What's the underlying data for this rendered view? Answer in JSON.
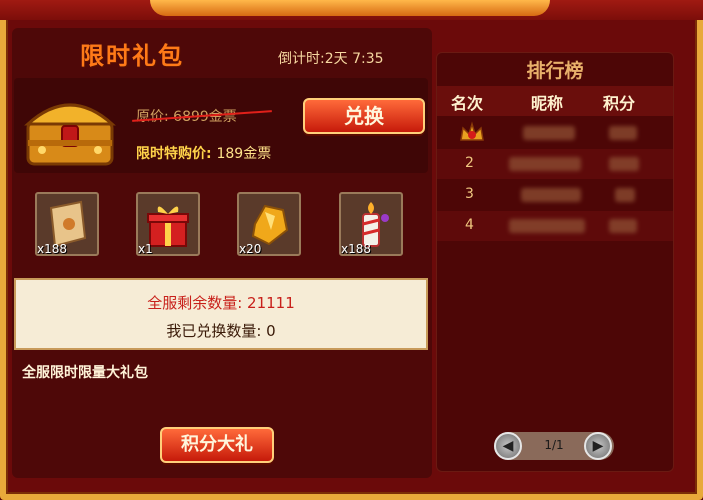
{
  "header": {
    "title": "限时礼包",
    "countdown": "倒计时:2天 7:35"
  },
  "offer": {
    "original_price": "原价: 6899金票",
    "sale_label": "限时特购价:",
    "sale_price": "189金票",
    "exchange_label": "兑换"
  },
  "items": [
    {
      "icon": "scroll-icon",
      "count": "x188"
    },
    {
      "icon": "gift-box-icon",
      "count": "x1"
    },
    {
      "icon": "gold-ore-icon",
      "count": "x20"
    },
    {
      "icon": "candle-icon",
      "count": "x188"
    }
  ],
  "stats": {
    "server_remaining": "全服剩余数量: 21111",
    "my_exchanged": "我已兑换数量: 0"
  },
  "description": "全服限时限量大礼包",
  "points_button": "积分大礼",
  "leaderboard": {
    "title": "排行榜",
    "columns": [
      "名次",
      "昵称",
      "积分"
    ],
    "rows": [
      {
        "rank": ""
      },
      {
        "rank": "2"
      },
      {
        "rank": "3"
      },
      {
        "rank": "4"
      }
    ],
    "pager": "1/1"
  },
  "colors": {
    "accent_orange": "#ff7a18",
    "button_red": "#c61a0a",
    "panel_dark_red": "#4e0808",
    "gold_text": "#ffd34a"
  }
}
